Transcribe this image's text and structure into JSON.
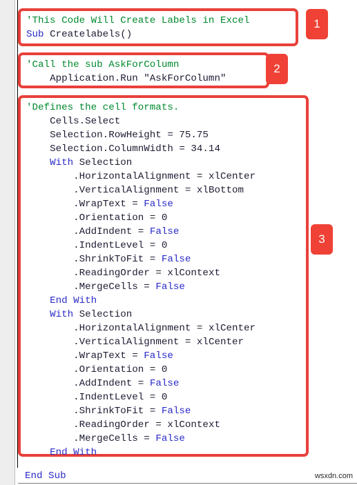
{
  "editor": {
    "watermark": "wsxdn.com",
    "trailing_line": "End Sub",
    "accent_color": "#ef4136",
    "comment_color": "#008a2e",
    "keyword_color": "#2b2bc9",
    "plain_color": "#1d1d33"
  },
  "badges": [
    {
      "label": "1"
    },
    {
      "label": "2"
    },
    {
      "label": "3"
    }
  ],
  "blocks": [
    {
      "id": "block-1",
      "badge": "1",
      "lines": [
        {
          "indent": "",
          "segments": [
            {
              "text": "'This Code Will Create Labels in Excel",
              "type": "comment"
            }
          ]
        },
        {
          "indent": "",
          "segments": [
            {
              "text": "Sub ",
              "type": "keyword"
            },
            {
              "text": "Createlabels()",
              "type": "plain"
            }
          ]
        }
      ]
    },
    {
      "id": "block-2",
      "badge": "2",
      "lines": [
        {
          "indent": "",
          "segments": [
            {
              "text": "'Call the sub AskForColumn",
              "type": "comment"
            }
          ]
        },
        {
          "indent": "    ",
          "segments": [
            {
              "text": "Application.Run \"AskForColumn\"",
              "type": "plain"
            }
          ]
        }
      ]
    },
    {
      "id": "block-3",
      "badge": "3",
      "lines": [
        {
          "indent": "",
          "segments": [
            {
              "text": "'Defines the cell formats.",
              "type": "comment"
            }
          ]
        },
        {
          "indent": "    ",
          "segments": [
            {
              "text": "Cells.Select",
              "type": "plain"
            }
          ]
        },
        {
          "indent": "    ",
          "segments": [
            {
              "text": "Selection.RowHeight = 75.75",
              "type": "plain"
            }
          ]
        },
        {
          "indent": "    ",
          "segments": [
            {
              "text": "Selection.ColumnWidth = 34.14",
              "type": "plain"
            }
          ]
        },
        {
          "indent": "    ",
          "segments": [
            {
              "text": "With ",
              "type": "keyword"
            },
            {
              "text": "Selection",
              "type": "plain"
            }
          ]
        },
        {
          "indent": "        ",
          "segments": [
            {
              "text": ".HorizontalAlignment = xlCenter",
              "type": "plain"
            }
          ]
        },
        {
          "indent": "        ",
          "segments": [
            {
              "text": ".VerticalAlignment = xlBottom",
              "type": "plain"
            }
          ]
        },
        {
          "indent": "        ",
          "segments": [
            {
              "text": ".WrapText = ",
              "type": "plain"
            },
            {
              "text": "False",
              "type": "keyword"
            }
          ]
        },
        {
          "indent": "        ",
          "segments": [
            {
              "text": ".Orientation = 0",
              "type": "plain"
            }
          ]
        },
        {
          "indent": "        ",
          "segments": [
            {
              "text": ".AddIndent = ",
              "type": "plain"
            },
            {
              "text": "False",
              "type": "keyword"
            }
          ]
        },
        {
          "indent": "        ",
          "segments": [
            {
              "text": ".IndentLevel = 0",
              "type": "plain"
            }
          ]
        },
        {
          "indent": "        ",
          "segments": [
            {
              "text": ".ShrinkToFit = ",
              "type": "plain"
            },
            {
              "text": "False",
              "type": "keyword"
            }
          ]
        },
        {
          "indent": "        ",
          "segments": [
            {
              "text": ".ReadingOrder = xlContext",
              "type": "plain"
            }
          ]
        },
        {
          "indent": "        ",
          "segments": [
            {
              "text": ".MergeCells = ",
              "type": "plain"
            },
            {
              "text": "False",
              "type": "keyword"
            }
          ]
        },
        {
          "indent": "    ",
          "segments": [
            {
              "text": "End With",
              "type": "keyword"
            }
          ]
        },
        {
          "indent": "    ",
          "segments": [
            {
              "text": "With ",
              "type": "keyword"
            },
            {
              "text": "Selection",
              "type": "plain"
            }
          ]
        },
        {
          "indent": "        ",
          "segments": [
            {
              "text": ".HorizontalAlignment = xlCenter",
              "type": "plain"
            }
          ]
        },
        {
          "indent": "        ",
          "segments": [
            {
              "text": ".VerticalAlignment = xlCenter",
              "type": "plain"
            }
          ]
        },
        {
          "indent": "        ",
          "segments": [
            {
              "text": ".WrapText = ",
              "type": "plain"
            },
            {
              "text": "False",
              "type": "keyword"
            }
          ]
        },
        {
          "indent": "        ",
          "segments": [
            {
              "text": ".Orientation = 0",
              "type": "plain"
            }
          ]
        },
        {
          "indent": "        ",
          "segments": [
            {
              "text": ".AddIndent = ",
              "type": "plain"
            },
            {
              "text": "False",
              "type": "keyword"
            }
          ]
        },
        {
          "indent": "        ",
          "segments": [
            {
              "text": ".IndentLevel = 0",
              "type": "plain"
            }
          ]
        },
        {
          "indent": "        ",
          "segments": [
            {
              "text": ".ShrinkToFit = ",
              "type": "plain"
            },
            {
              "text": "False",
              "type": "keyword"
            }
          ]
        },
        {
          "indent": "        ",
          "segments": [
            {
              "text": ".ReadingOrder = xlContext",
              "type": "plain"
            }
          ]
        },
        {
          "indent": "        ",
          "segments": [
            {
              "text": ".MergeCells = ",
              "type": "plain"
            },
            {
              "text": "False",
              "type": "keyword"
            }
          ]
        },
        {
          "indent": "    ",
          "segments": [
            {
              "text": "End With",
              "type": "keyword"
            }
          ]
        }
      ]
    }
  ]
}
